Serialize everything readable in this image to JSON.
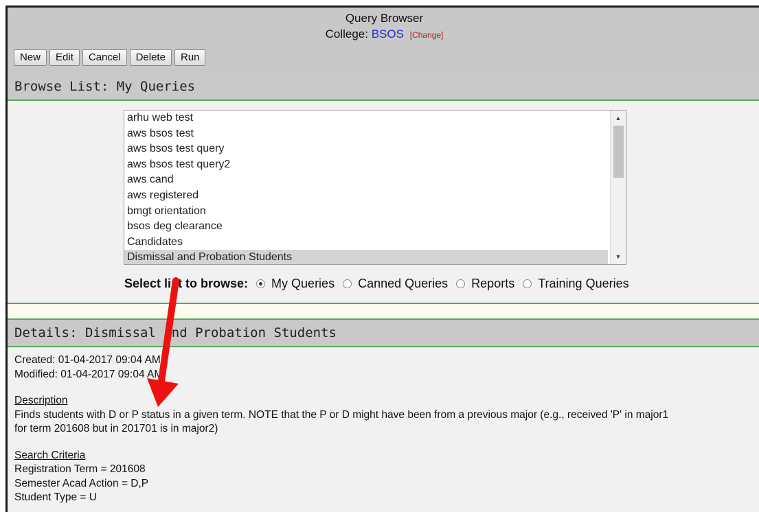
{
  "header": {
    "title": "Query Browser",
    "college_label": "College:",
    "college_code": "BSOS",
    "change_link": "[Change]"
  },
  "toolbar": {
    "new_label": "New",
    "edit_label": "Edit",
    "cancel_label": "Cancel",
    "delete_label": "Delete",
    "run_label": "Run"
  },
  "browse": {
    "title": "Browse List: My Queries",
    "items": [
      "arhu web test",
      "aws bsos test",
      "aws bsos test query",
      "aws bsos test query2",
      "aws cand",
      "aws registered",
      "bmgt orientation",
      "bsos deg clearance",
      "Candidates",
      "Dismissal and Probation Students"
    ],
    "selected_item": "Dismissal and Probation Students",
    "selector_label": "Select list to browse:",
    "options": [
      "My Queries",
      "Canned Queries",
      "Reports",
      "Training Queries"
    ],
    "selected_option": "My Queries"
  },
  "details": {
    "title": "Details: Dismissal and Probation Students",
    "created": "Created: 01-04-2017 09:04 AM",
    "modified": "Modified: 01-04-2017 09:04 AM",
    "description_heading": "Description",
    "description_line1": "Finds students with D or P status in a given term. NOTE that the P or D might have been from a previous major (e.g., received 'P' in major1",
    "description_line2": "for term 201608 but in 201701 is in major2)",
    "criteria_heading": "Search Criteria",
    "criteria": [
      "Registration Term = 201608",
      "Semester Acad Action = D,P",
      "Student Type = U"
    ]
  },
  "colors": {
    "border_green": "#5aa95a",
    "header_gray": "#c8c8c8",
    "college_link": "#2a2ad8",
    "change_link": "#b02020",
    "arrow_red": "#ee1111"
  }
}
